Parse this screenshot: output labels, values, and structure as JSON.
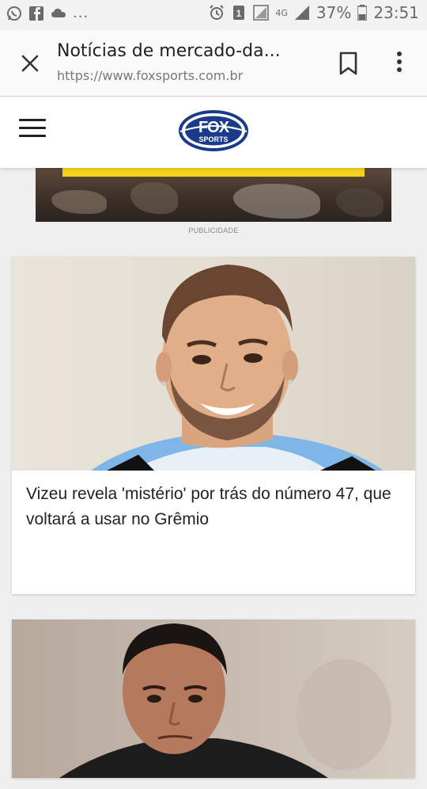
{
  "status_bar": {
    "battery": "37%",
    "time": "23:51",
    "network": "4G",
    "more": "..."
  },
  "toolbar": {
    "title": "Notícias de mercado-da...",
    "url": "https://www.foxsports.com.br"
  },
  "site": {
    "logo_text": "FOX SPORTS"
  },
  "ad": {
    "label": "PUBLICIDADE"
  },
  "articles": [
    {
      "headline": "Vizeu revela 'mistério' por trás do número 47, que voltará a usar no Grêmio"
    },
    {
      "headline": ""
    }
  ],
  "colors": {
    "accent_yellow": "#f5d21b",
    "fox_blue": "#1a3a8a"
  }
}
